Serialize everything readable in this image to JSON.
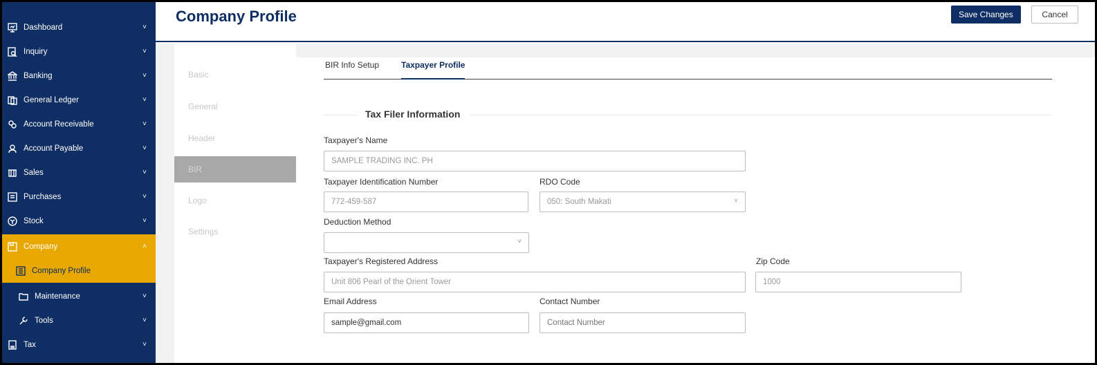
{
  "sidebar": {
    "items": [
      {
        "label": "Dashboard",
        "icon": "dashboard-icon"
      },
      {
        "label": "Inquiry",
        "icon": "inquiry-icon"
      },
      {
        "label": "Banking",
        "icon": "bank-icon"
      },
      {
        "label": "General Ledger",
        "icon": "ledger-icon"
      },
      {
        "label": "Account Receivable",
        "icon": "receivable-icon"
      },
      {
        "label": "Account Payable",
        "icon": "payable-icon"
      },
      {
        "label": "Sales",
        "icon": "sales-icon"
      },
      {
        "label": "Purchases",
        "icon": "purchases-icon"
      },
      {
        "label": "Stock",
        "icon": "stock-icon"
      },
      {
        "label": "Company",
        "icon": "company-icon"
      },
      {
        "label": "Company Profile",
        "icon": "profile-icon"
      },
      {
        "label": "Maintenance",
        "icon": "folder-icon"
      },
      {
        "label": "Tools",
        "icon": "wrench-icon"
      },
      {
        "label": "Tax",
        "icon": "tax-icon"
      }
    ],
    "chevron_down": "˅",
    "chevron_up": "˄"
  },
  "header": {
    "title": "Company Profile",
    "save_label": "Save Changes",
    "cancel_label": "Cancel"
  },
  "section_menu": {
    "items": [
      "Basic",
      "General",
      "Header",
      "BIR",
      "Logo",
      "Settings"
    ],
    "active": "BIR"
  },
  "tabs": {
    "items": [
      "BIR Info Setup",
      "Taxpayer Profile"
    ],
    "active": "Taxpayer Profile"
  },
  "form": {
    "section_title": "Tax Filer Information",
    "taxpayer_name": {
      "label": "Taxpayer's Name",
      "value": "SAMPLE TRADING INC. PH"
    },
    "tin": {
      "label": "Taxpayer Identification Number",
      "value": "772-459-587"
    },
    "rdo": {
      "label": "RDO Code",
      "value": "050: South Makati"
    },
    "deduction": {
      "label": "Deduction Method",
      "value": ""
    },
    "address": {
      "label": "Taxpayer's Registered Address",
      "value": "Unit 806 Pearl of the Orient Tower"
    },
    "zip": {
      "label": "Zip Code",
      "value": "1000"
    },
    "email": {
      "label": "Email Address",
      "value": "sample@gmail.com"
    },
    "contact": {
      "label": "Contact Number",
      "placeholder": "Contact Number",
      "value": ""
    }
  },
  "colors": {
    "navy": "#0f2e63",
    "accent": "#e8a800"
  }
}
